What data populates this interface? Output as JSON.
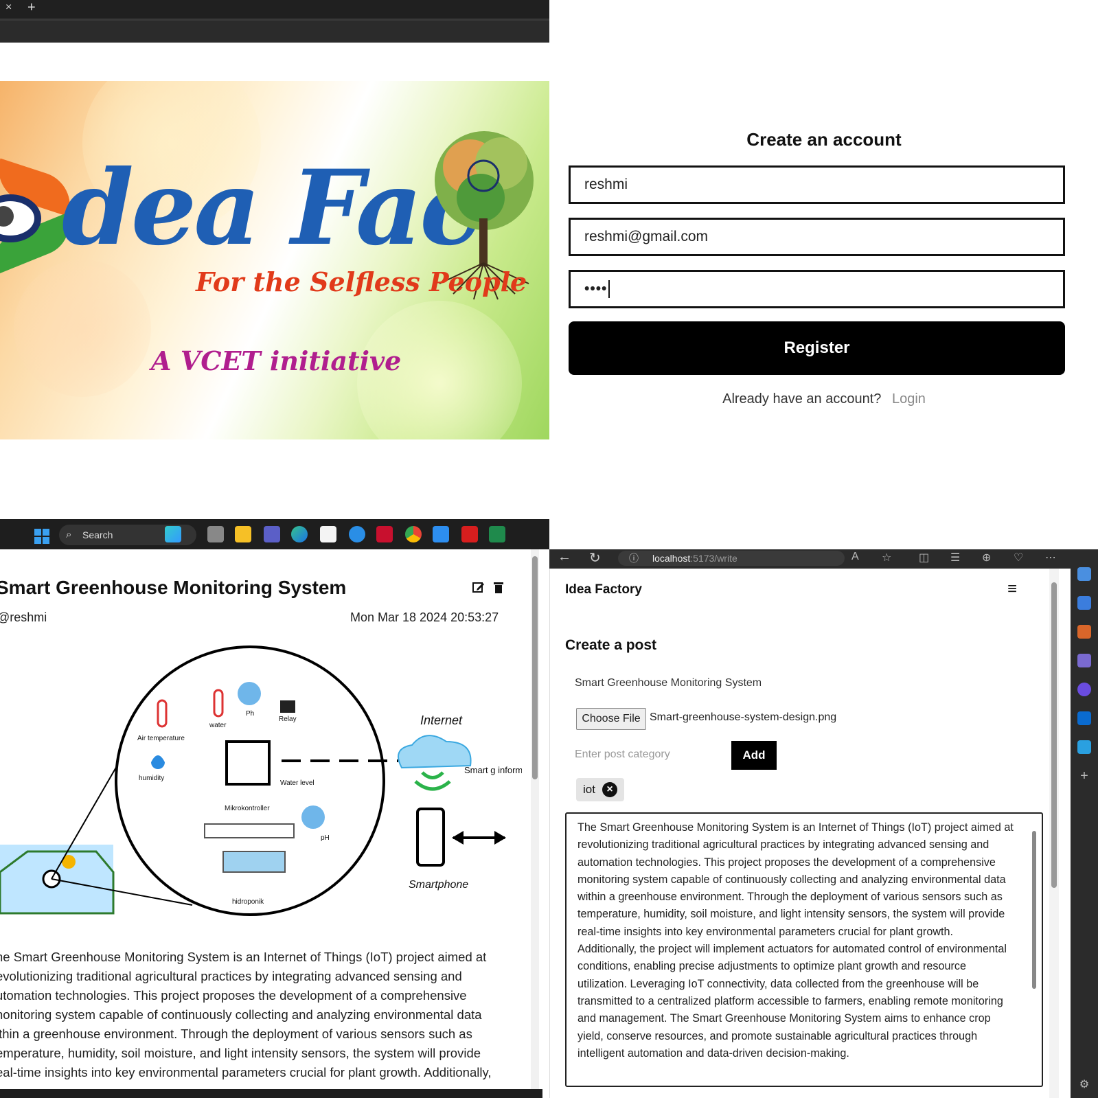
{
  "top_browser": {
    "close_tab": "×",
    "new_tab": "+"
  },
  "banner": {
    "title": "dea Fac",
    "tagline": "For the Selfless People",
    "initiative": "A VCET initiative",
    "colors": {
      "title": "#1f5fb4",
      "tagline": "#e13a1a",
      "initiative": "#b01e8e"
    }
  },
  "register": {
    "heading": "Create an account",
    "username": "reshmi",
    "email": "reshmi@gmail.com",
    "password_mask": "••••",
    "button": "Register",
    "prompt": "Already have an account?",
    "login_link": "Login"
  },
  "taskbar": {
    "search_label": "Search",
    "apps": [
      "widgets-icon",
      "task-view-icon",
      "file-explorer-icon",
      "teams-icon",
      "edge-icon",
      "store-icon",
      "weather-icon",
      "mcafee-icon",
      "chrome-icon",
      "vscode-icon",
      "acrobat-icon",
      "excel-icon"
    ]
  },
  "post": {
    "title": "Smart Greenhouse Monitoring System",
    "author": "@reshmi",
    "date": "Mon Mar 18 2024  20:53:27",
    "diagram": {
      "internet": "Internet",
      "smartphone": "Smartphone",
      "air_temp": "Air temperature",
      "water": "water",
      "ph_top": "Ph",
      "relay": "Relay",
      "humidity": "humidity",
      "water_level": "Water level",
      "mikro": "Mikrokontroller",
      "ph": "pH",
      "hidroponik": "hidroponik",
      "smart_info": "Smart g informati re"
    },
    "body": "he Smart Greenhouse Monitoring System is an Internet of Things (IoT) project aimed at evolutionizing traditional agricultural practices by integrating advanced sensing and utomation technologies. This project proposes the development of a comprehensive nonitoring system capable of continuously collecting and analyzing environmental data ithin a greenhouse environment. Through the deployment of various sensors such as emperature, humidity, soil moisture, and light intensity sensors, the system will provide eal-time insights into key environmental parameters crucial for plant growth. Additionally,"
  },
  "edge": {
    "url_host": "localhost",
    "url_path": ":5173/write"
  },
  "editor": {
    "brand": "Idea Factory",
    "section": "Create a post",
    "post_title": "Smart Greenhouse Monitoring System",
    "file_button": "Choose File",
    "file_name": "Smart-greenhouse-system-design.png",
    "category_placeholder": "Enter post category",
    "add_button": "Add",
    "categories": [
      "iot"
    ],
    "description": "The Smart Greenhouse Monitoring System is an Internet of Things (IoT) project aimed at revolutionizing traditional agricultural practices by integrating advanced sensing and automation technologies. This project proposes the development of a comprehensive monitoring system capable of continuously collecting and analyzing environmental data within a greenhouse environment. Through the deployment of various sensors such as temperature, humidity, soil moisture, and light intensity sensors, the system will provide real-time insights into key environmental parameters crucial for plant growth. Additionally, the project will implement actuators for automated control of environmental conditions, enabling precise adjustments to optimize plant growth and resource utilization. Leveraging IoT connectivity, data collected from the greenhouse will be transmitted to a centralized platform accessible to farmers, enabling remote monitoring and management. The Smart Greenhouse Monitoring System aims to enhance crop yield, conserve resources, and promote sustainable agricultural practices through intelligent automation and data-driven decision-making."
  }
}
